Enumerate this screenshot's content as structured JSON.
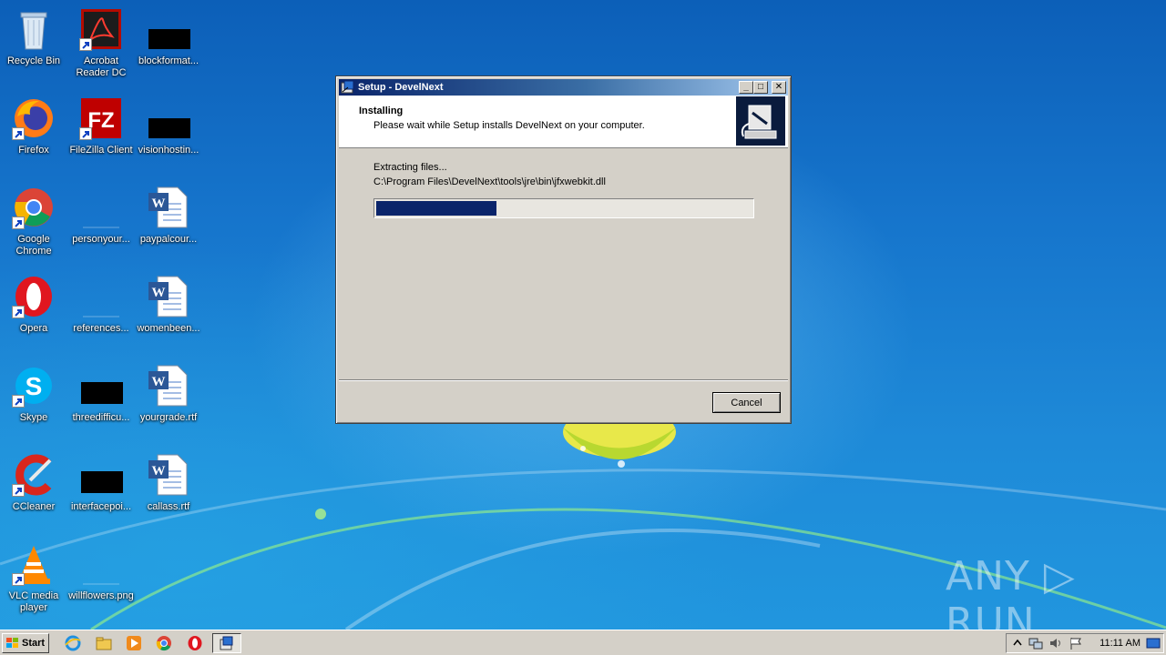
{
  "desktop": {
    "icons": [
      {
        "label": "Recycle Bin"
      },
      {
        "label": "Acrobat Reader DC"
      },
      {
        "label": "blockformat..."
      },
      {
        "label": "Firefox"
      },
      {
        "label": "FileZilla Client"
      },
      {
        "label": "visionhostin..."
      },
      {
        "label": "Google Chrome"
      },
      {
        "label": "personyour..."
      },
      {
        "label": "paypalcour..."
      },
      {
        "label": "Opera"
      },
      {
        "label": "references..."
      },
      {
        "label": "womenbeen..."
      },
      {
        "label": "Skype"
      },
      {
        "label": "threedifficu..."
      },
      {
        "label": "yourgrade.rtf"
      },
      {
        "label": "CCleaner"
      },
      {
        "label": "interfacepoi..."
      },
      {
        "label": "callass.rtf"
      },
      {
        "label": "VLC media player"
      },
      {
        "label": "willflowers.png"
      }
    ]
  },
  "dialog": {
    "title": "Setup - DevelNext",
    "heading": "Installing",
    "subheading": "Please wait while Setup installs DevelNext on your computer.",
    "status": "Extracting files...",
    "file_path": "C:\\Program Files\\DevelNext\\tools\\jre\\bin\\jfxwebkit.dll",
    "progress_fraction": 0.32,
    "cancel_label": "Cancel",
    "minimize_glyph": "_",
    "maximize_glyph": "□",
    "close_glyph": "✕"
  },
  "taskbar": {
    "start_label": "Start",
    "clock": "11:11 AM"
  },
  "watermark": {
    "text": "ANY ▷ RUN"
  }
}
